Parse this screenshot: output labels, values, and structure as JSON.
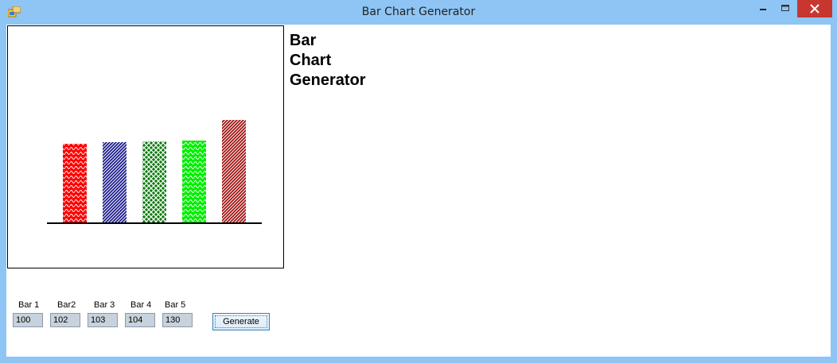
{
  "window": {
    "title": "Bar Chart Generator",
    "icon": "app-window-icon",
    "controls": {
      "minimize_icon": "minimize-icon",
      "maximize_icon": "maximize-icon",
      "close_icon": "close-icon"
    }
  },
  "heading": {
    "lines": [
      "Bar",
      "Chart",
      "Generator"
    ]
  },
  "bars": [
    {
      "label": "Bar 1",
      "value": "100",
      "color": "#ff0000",
      "pattern": "wave"
    },
    {
      "label": "Bar2",
      "value": "102",
      "color": "#1a1a8c",
      "pattern": "diagonal"
    },
    {
      "label": "Bar 3",
      "value": "103",
      "color": "#0a7a0a",
      "pattern": "cross"
    },
    {
      "label": "Bar 4",
      "value": "104",
      "color": "#00ee00",
      "pattern": "wave"
    },
    {
      "label": "Bar 5",
      "value": "130",
      "color": "#a01010",
      "pattern": "diagonal"
    }
  ],
  "generate_label": "Generate",
  "chart_data": {
    "type": "bar",
    "categories": [
      "Bar 1",
      "Bar2",
      "Bar 3",
      "Bar 4",
      "Bar 5"
    ],
    "values": [
      100,
      102,
      103,
      104,
      130
    ],
    "colors": [
      "#ff0000",
      "#1a1a8c",
      "#0a7a0a",
      "#00ee00",
      "#a01010"
    ],
    "grid": false,
    "ylim": [
      0,
      130
    ]
  }
}
